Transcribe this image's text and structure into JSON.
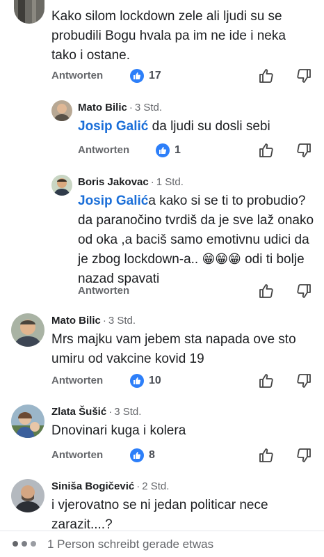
{
  "comments": [
    {
      "text": "Kako silom lockdown zele ali ljudi su se probudili Bogu hvala pa im ne ide i neka tako i ostane.",
      "reply_label": "Antworten",
      "likes": "17"
    },
    {
      "author": "Mato Bilic",
      "time": "3 Std.",
      "mention": "Josip Galić",
      "text": " da ljudi su dosli sebi",
      "reply_label": "Antworten",
      "likes": "1"
    },
    {
      "author": "Boris Jakovac",
      "time": "1 Std.",
      "mention": "Josip Galić",
      "text": "a kako si se ti to probudio? da paranočino tvrdiš da je sve laž onako od oka ,a baciš samo emotivnu udici da je  zbog lockdown-a.. ",
      "emojis": "😁😁😁",
      "text_end": " odi ti bolje nazad spavati",
      "reply_label": "Antworten"
    },
    {
      "author": "Mato Bilic",
      "time": "3 Std.",
      "text": "Mrs majku vam jebem sta napada ove sto umiru od vakcine kovid 19",
      "reply_label": "Antworten",
      "likes": "10"
    },
    {
      "author": "Zlata Šušić",
      "time": "3 Std.",
      "text": "Dnovinari kuga i kolera",
      "reply_label": "Antworten",
      "likes": "8"
    },
    {
      "author": "Siniša Bogičević",
      "time": "2 Std.",
      "text": "i vjerovatno se ni jedan politicar nece zarazit....?"
    }
  ],
  "footer": {
    "typing_text": "1 Person schreibt gerade etwas"
  },
  "colors": {
    "mention": "#1a6ed8",
    "like_badge": "#2d7ff9",
    "secondary_text": "#65676b"
  },
  "icons": [
    "like-icon",
    "upvote-icon",
    "downvote-icon",
    "avatar",
    "typing-dots-icon"
  ]
}
